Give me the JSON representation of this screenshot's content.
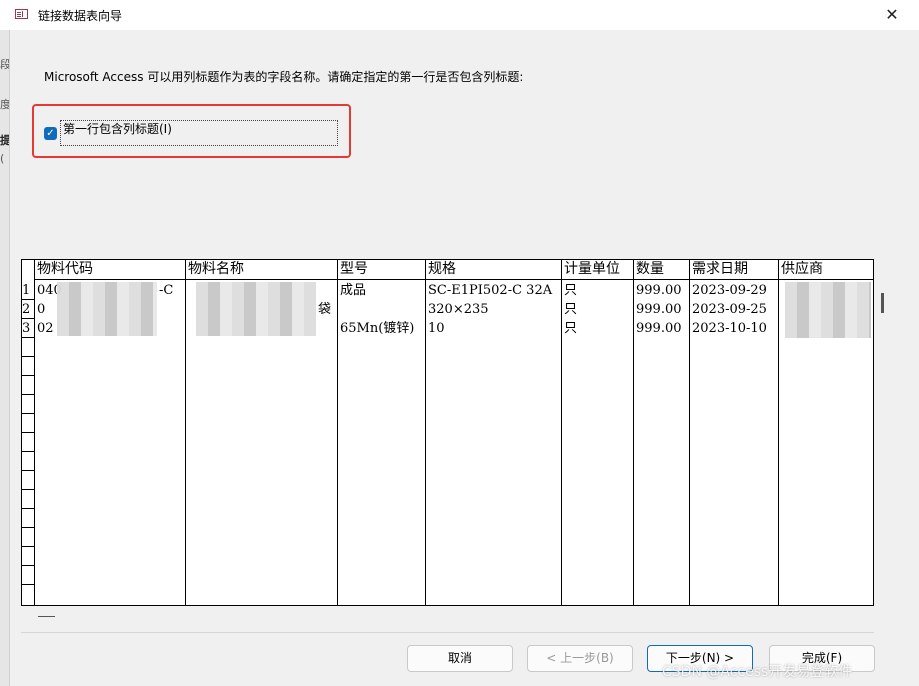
{
  "window": {
    "title": "链接数据表向导",
    "close_glyph": "✕"
  },
  "instruction": "Microsoft Access 可以用列标题作为表的字段名称。请确定指定的第一行是否包含列标题:",
  "checkbox": {
    "checked": true,
    "check_glyph": "✓",
    "label": "第一行包含列标题(I)"
  },
  "grid": {
    "row_numbers": [
      "1",
      "2",
      "3"
    ],
    "columns": [
      "物料代码",
      "物料名称",
      "型号",
      "规格",
      "计量单位",
      "数量",
      "需求日期",
      "供应商"
    ],
    "rows": [
      [
        "040",
        "",
        "成品",
        "SC-E1PI502-C 32A",
        "只",
        "999.00",
        "2023-09-29",
        ""
      ],
      [
        "0",
        "",
        "",
        "320×235",
        "只",
        "999.00",
        "2023-09-25",
        ""
      ],
      [
        "02",
        "",
        "65Mn(镀锌)",
        "10",
        "只",
        "999.00",
        "2023-10-10",
        ""
      ]
    ],
    "visible_fragments": {
      "row1_code_suffix": "-C",
      "row2_name_suffix": "袋"
    }
  },
  "buttons": {
    "cancel": "取消",
    "back": "< 上一步(B)",
    "next": "下一步(N) >",
    "finish": "完成(F)"
  },
  "watermark": "CSDN @Access开发易登软件",
  "left_fragments": [
    "段",
    "度",
    "提",
    "("
  ]
}
